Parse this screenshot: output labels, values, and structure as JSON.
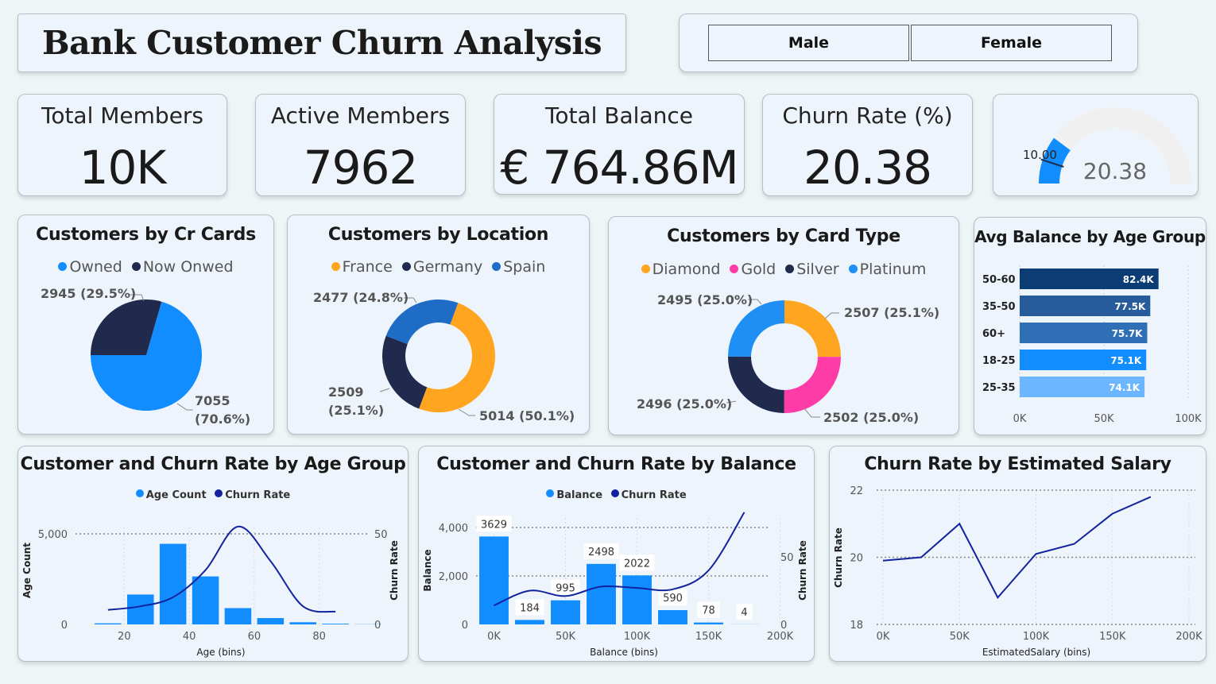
{
  "header": {
    "title": "Bank Customer Churn Analysis"
  },
  "slicer": {
    "options": [
      "Male",
      "Female"
    ]
  },
  "kpis": [
    {
      "label": "Total Members",
      "value": "10K"
    },
    {
      "label": "Active Members",
      "value": "7962"
    },
    {
      "label": "Total Balance",
      "value": "€ 764.86M"
    },
    {
      "label": "Churn Rate (%)",
      "value": "20.38"
    }
  ],
  "gauge": {
    "target_label": "10.00",
    "value_label": "20.38",
    "value": 20.38,
    "target": 10,
    "min": 0,
    "max": 100,
    "fill_color": "#118dff",
    "track_color": "#f0f0f0"
  },
  "chart_data": [
    {
      "type": "pie",
      "title": "Customers by Cr Cards",
      "categories": [
        "Owned",
        "Now Onwed"
      ],
      "values": [
        7055,
        2945
      ],
      "labels": [
        "7055\n(70.6%)",
        "2945 (29.5%)"
      ],
      "colors": [
        "#118dff",
        "#1f2a4d"
      ]
    },
    {
      "type": "pie",
      "donut": true,
      "title": "Customers by Location",
      "categories": [
        "France",
        "Germany",
        "Spain"
      ],
      "values": [
        5014,
        2509,
        2477
      ],
      "labels": [
        "5014 (50.1%)",
        "2509\n(25.1%)",
        "2477 (24.8%)"
      ],
      "colors": [
        "#ffa51f",
        "#1f2a4d",
        "#1f6cc7"
      ]
    },
    {
      "type": "pie",
      "donut": true,
      "title": "Customers by Card Type",
      "categories": [
        "Diamond",
        "Gold",
        "Silver",
        "Platinum"
      ],
      "values": [
        2507,
        2502,
        2496,
        2495
      ],
      "labels": [
        "2507 (25.1%)",
        "2502 (25.0%)",
        "2496 (25.0%)",
        "2495 (25.0%)"
      ],
      "colors": [
        "#ffa51f",
        "#ff3ba8",
        "#1f2a4d",
        "#1f8ff5"
      ]
    },
    {
      "type": "bar",
      "orientation": "horizontal",
      "title": "Avg Balance by Age Group",
      "categories": [
        "50-60",
        "35-50",
        "60+",
        "18-25",
        "25-35"
      ],
      "values": [
        82400,
        77500,
        75700,
        75100,
        74100
      ],
      "value_labels": [
        "82.4K",
        "77.5K",
        "75.7K",
        "75.1K",
        "74.1K"
      ],
      "colors": [
        "#0b3c74",
        "#275c9c",
        "#2e6fb6",
        "#118dff",
        "#6cb6ff"
      ],
      "xlim": [
        0,
        100000
      ],
      "xticks": [
        "0K",
        "50K",
        "100K"
      ]
    },
    {
      "type": "bar",
      "title": "Customer and Churn Rate by Age Group",
      "legend": [
        "Age Count",
        "Churn Rate"
      ],
      "xlabel": "Age (bins)",
      "ylabel": "Age Count",
      "y2label": "Churn Rate",
      "x": [
        10,
        20,
        30,
        40,
        50,
        60,
        70,
        80,
        90
      ],
      "bar_values": [
        60,
        1650,
        4450,
        2650,
        900,
        350,
        120,
        40,
        10
      ],
      "line_x": [
        10,
        20,
        30,
        40,
        50,
        60,
        70,
        80
      ],
      "line_values": [
        8,
        10,
        15,
        30,
        54,
        35,
        10,
        7
      ],
      "ylim": [
        0,
        5000
      ],
      "y2lim": [
        0,
        50
      ],
      "xticks": [
        "20",
        "40",
        "60",
        "80"
      ],
      "yticks": [
        "0",
        "5,000"
      ],
      "y2ticks": [
        "0",
        "50"
      ]
    },
    {
      "type": "bar",
      "title": "Customer and Churn Rate by Balance",
      "legend": [
        "Balance",
        "Churn Rate"
      ],
      "xlabel": "Balance (bins)",
      "ylabel": "Balance",
      "y2label": "Churn Rate",
      "x": [
        0,
        25000,
        50000,
        100000,
        125000,
        150000,
        175000,
        200000
      ],
      "bar_values": [
        3629,
        184,
        995,
        2498,
        2022,
        590,
        78,
        4
      ],
      "bar_labels": [
        "3629",
        "184",
        "995",
        "2498",
        "2022",
        "590",
        "78",
        "4"
      ],
      "line_x": [
        0,
        25000,
        50000,
        100000,
        125000,
        150000,
        175000,
        200000
      ],
      "line_values": [
        14,
        25,
        21,
        28,
        27,
        26,
        40,
        83
      ],
      "ylim": [
        0,
        4000
      ],
      "y2lim": [
        0,
        50
      ],
      "xticks": [
        "0K",
        "50K",
        "100K",
        "150K",
        "200K"
      ],
      "yticks": [
        "0",
        "2,000",
        "4,000"
      ],
      "y2ticks": [
        "0",
        "50"
      ]
    },
    {
      "type": "line",
      "title": "Churn Rate by Estimated Salary",
      "xlabel": "EstimatedSalary (bins)",
      "ylabel": "Churn Rate",
      "x": [
        0,
        25000,
        50000,
        75000,
        100000,
        125000,
        150000,
        175000
      ],
      "values": [
        19.9,
        20.0,
        21.0,
        18.8,
        20.1,
        20.4,
        21.3,
        21.8
      ],
      "xlim": [
        0,
        200000
      ],
      "ylim": [
        18,
        22
      ],
      "xticks": [
        "0K",
        "50K",
        "100K",
        "150K",
        "200K"
      ],
      "yticks": [
        "18",
        "20",
        "22"
      ]
    }
  ]
}
